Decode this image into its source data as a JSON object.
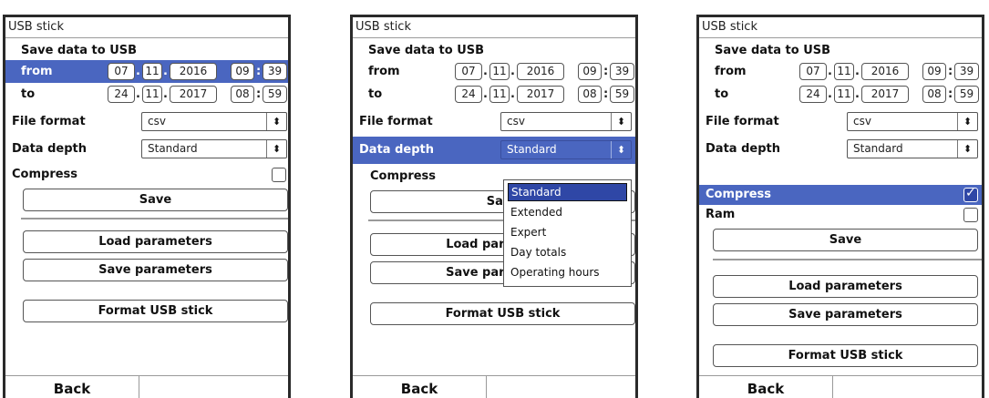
{
  "screens": [
    {
      "title": "USB stick",
      "section_heading": "Save data to USB",
      "from": {
        "label": "from",
        "day": "07",
        "month": "11",
        "year": "2016",
        "hour": "09",
        "minute": "39"
      },
      "to": {
        "label": "to",
        "day": "24",
        "month": "11",
        "year": "2017",
        "hour": "08",
        "minute": "59"
      },
      "file_format": {
        "label": "File format",
        "value": "csv"
      },
      "data_depth": {
        "label": "Data depth",
        "value": "Standard"
      },
      "compress": {
        "label": "Compress",
        "checked": false
      },
      "save_label": "Save",
      "load_parameters_label": "Load parameters",
      "save_parameters_label": "Save parameters",
      "format_usb_label": "Format USB stick",
      "back_label": "Back",
      "highlighted_row": "from"
    },
    {
      "title": "USB stick",
      "section_heading": "Save data to USB",
      "from": {
        "label": "from",
        "day": "07",
        "month": "11",
        "year": "2016",
        "hour": "09",
        "minute": "39"
      },
      "to": {
        "label": "to",
        "day": "24",
        "month": "11",
        "year": "2017",
        "hour": "08",
        "minute": "59"
      },
      "file_format": {
        "label": "File format",
        "value": "csv"
      },
      "data_depth": {
        "label": "Data depth",
        "value": "Standard"
      },
      "compress": {
        "label": "Compress",
        "checked": false
      },
      "save_label": "Save",
      "load_parameters_label": "Load parameters",
      "save_parameters_label": "Save parameters",
      "format_usb_label": "Format USB stick",
      "back_label": "Back",
      "highlighted_row": "data_depth",
      "dropdown_options": [
        "Standard",
        "Extended",
        "Expert",
        "Day totals",
        "Operating hours"
      ],
      "dropdown_selected": "Standard"
    },
    {
      "title": "USB stick",
      "section_heading": "Save data to USB",
      "from": {
        "label": "from",
        "day": "07",
        "month": "11",
        "year": "2016",
        "hour": "09",
        "minute": "39"
      },
      "to": {
        "label": "to",
        "day": "24",
        "month": "11",
        "year": "2017",
        "hour": "08",
        "minute": "59"
      },
      "file_format": {
        "label": "File format",
        "value": "csv"
      },
      "data_depth": {
        "label": "Data depth",
        "value": "Standard"
      },
      "compress": {
        "label": "Compress",
        "checked": true
      },
      "ram": {
        "label": "Ram",
        "checked": false
      },
      "save_label": "Save",
      "load_parameters_label": "Load parameters",
      "save_parameters_label": "Save parameters",
      "format_usb_label": "Format USB stick",
      "back_label": "Back",
      "highlighted_row": "compress"
    }
  ],
  "colors": {
    "highlight": "#4a66c0",
    "selected_option": "#2f47a6",
    "frame": "#2a2a2a"
  },
  "icons": {
    "select_arrow": "up-down-arrows-icon",
    "checkbox_checked": "checkmark-icon"
  }
}
